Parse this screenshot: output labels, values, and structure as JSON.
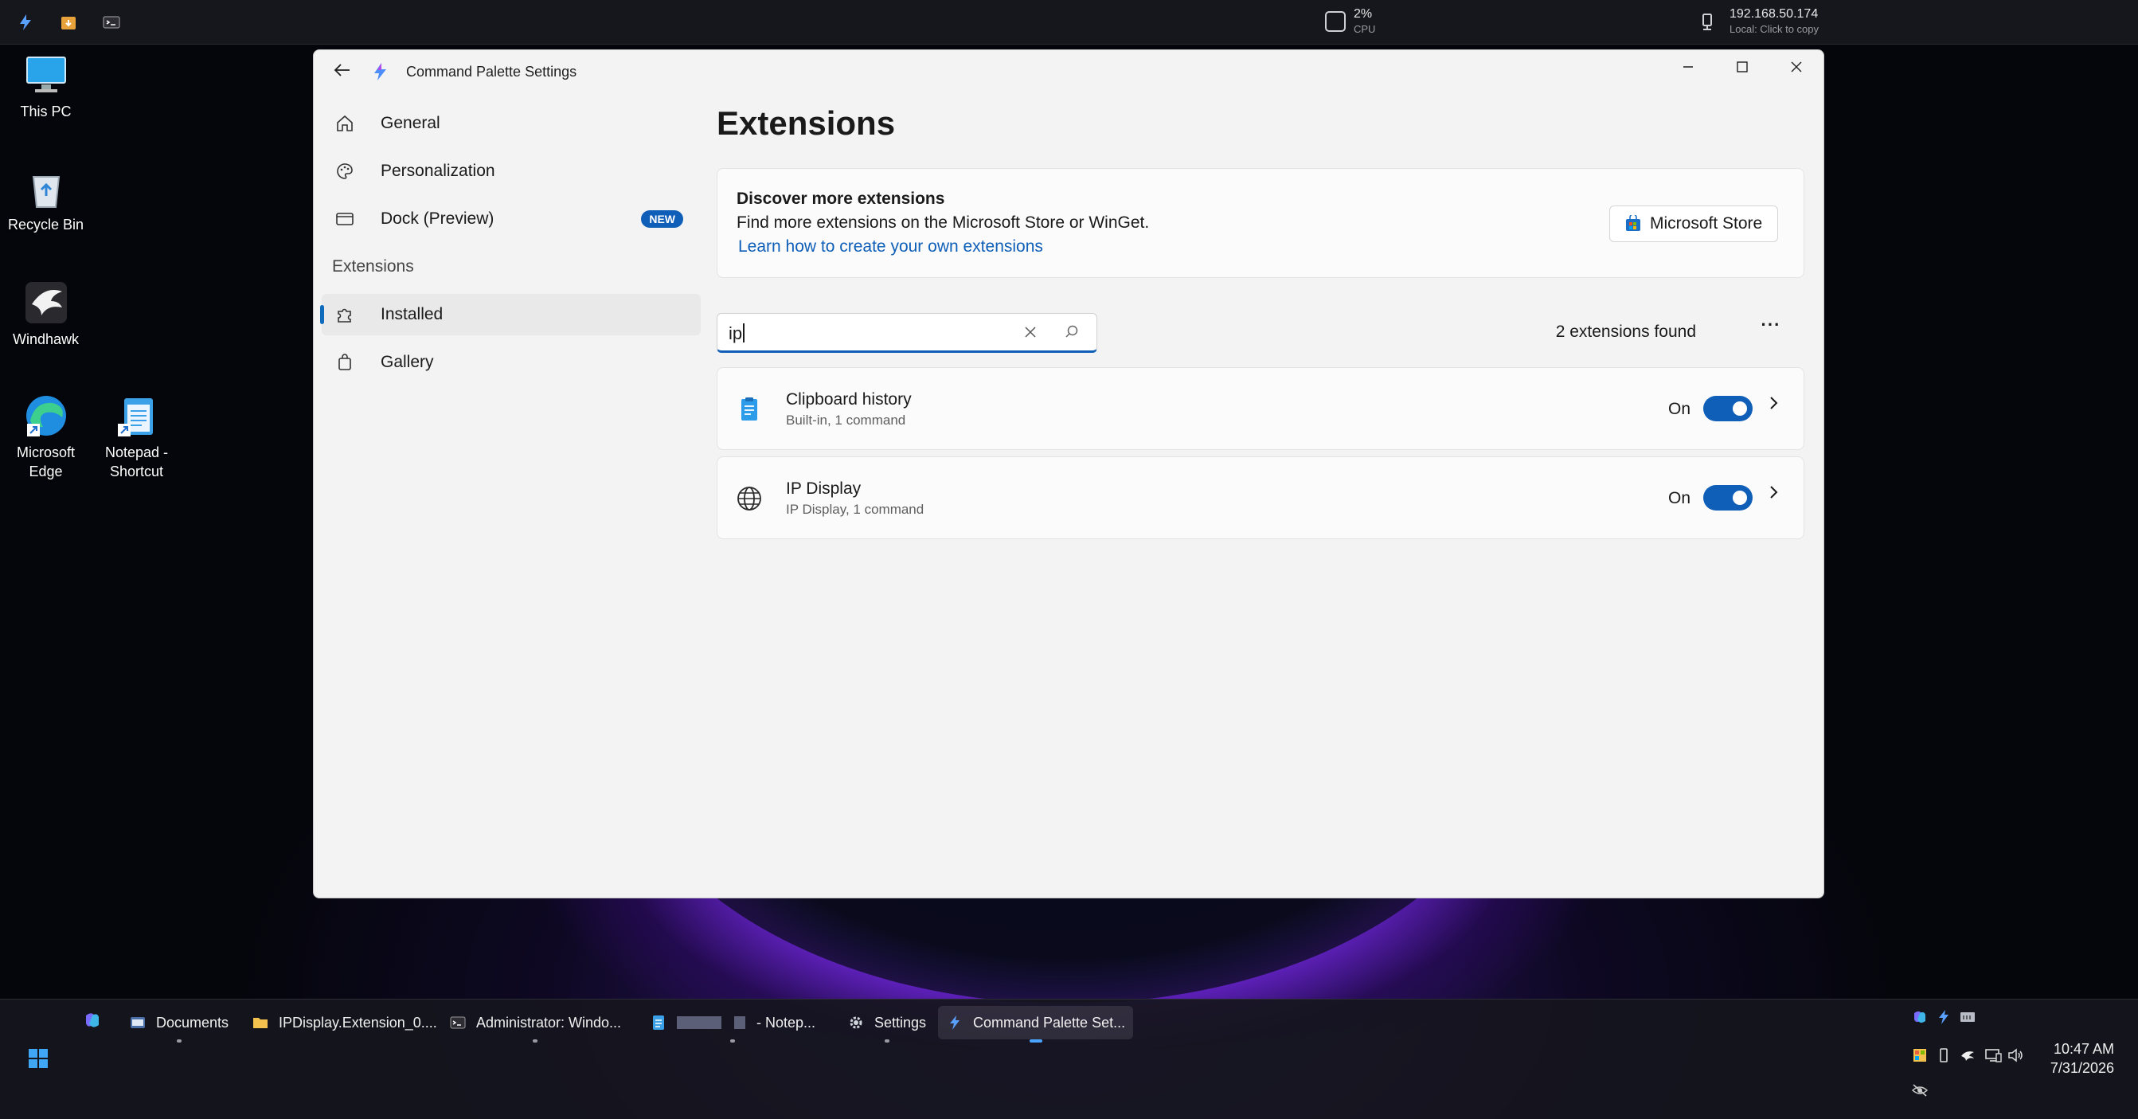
{
  "topbar": {
    "cpu_value": "2%",
    "cpu_label": "CPU",
    "ip_value": "192.168.50.174",
    "ip_hint": "Local: Click to copy"
  },
  "desktop": {
    "icons": [
      {
        "label": "This PC"
      },
      {
        "label": "Recycle Bin"
      },
      {
        "label": "Windhawk"
      },
      {
        "label": "Microsoft Edge"
      },
      {
        "label": "Notepad - Shortcut"
      }
    ]
  },
  "window": {
    "title": "Command Palette Settings",
    "nav": {
      "items": [
        {
          "label": "General"
        },
        {
          "label": "Personalization"
        },
        {
          "label": "Dock (Preview)",
          "badge": "NEW"
        }
      ],
      "section_header": "Extensions",
      "section_items": [
        {
          "label": "Installed"
        },
        {
          "label": "Gallery"
        }
      ]
    },
    "page_title": "Extensions",
    "discover": {
      "title": "Discover more extensions",
      "description": "Find more extensions on the Microsoft Store or WinGet.",
      "link": "Learn how to create your own extensions",
      "store_button": "Microsoft Store"
    },
    "search": {
      "value": "ip"
    },
    "results_count": "2 extensions found",
    "extensions": [
      {
        "name": "Clipboard history",
        "subtitle": "Built-in, 1 command",
        "state": "On",
        "enabled": true,
        "icon": "clipboard-icon"
      },
      {
        "name": "IP Display",
        "subtitle": "IP Display, 1 command",
        "state": "On",
        "enabled": true,
        "icon": "globe-icon"
      }
    ]
  },
  "taskbar": {
    "apps": [
      {
        "label": "Documents",
        "icon": "explorer-icon"
      },
      {
        "label": "IPDisplay.Extension_0....",
        "icon": "folder-icon"
      },
      {
        "label": "Administrator: Windo...",
        "icon": "terminal-icon"
      },
      {
        "label": "- Notep...",
        "icon": "notepad-icon"
      },
      {
        "label": "Settings",
        "icon": "gear-icon"
      },
      {
        "label": "Command Palette Set...",
        "icon": "command-palette-icon"
      }
    ],
    "time": "10:47 AM",
    "date": "7/31/2026"
  },
  "colors": {
    "accent": "#0f5fb8",
    "window_bg": "#f3f3f3",
    "taskbar_bg": "#16161e"
  }
}
